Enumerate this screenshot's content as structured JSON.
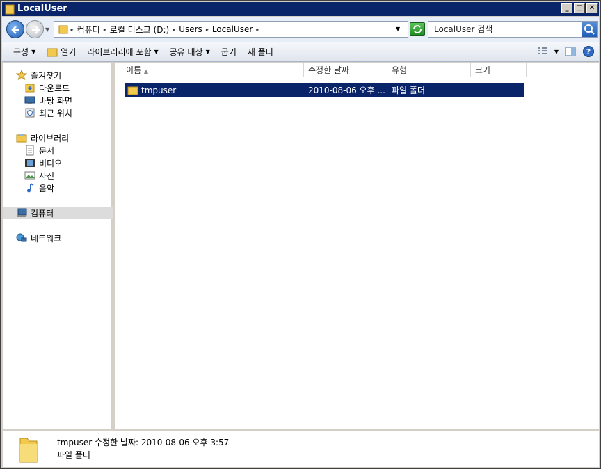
{
  "window": {
    "title": "LocalUser"
  },
  "title_buttons": [
    "_",
    "□",
    "✕"
  ],
  "address": {
    "crumbs": [
      "컴퓨터",
      "로컬 디스크 (D:)",
      "Users",
      "LocalUser"
    ]
  },
  "search": {
    "placeholder": "LocalUser 검색"
  },
  "commands": [
    {
      "label": "구성",
      "caret": "▼"
    },
    {
      "label": "열기"
    },
    {
      "label": "라이브러리에 포함",
      "caret": "▼"
    },
    {
      "label": "공유 대상",
      "caret": "▼"
    },
    {
      "label": "굽기"
    },
    {
      "label": "새 폴더"
    }
  ],
  "sidebar": {
    "favorites": {
      "label": "즐겨찾기",
      "items": [
        "다운로드",
        "바탕 화면",
        "최근 위치"
      ]
    },
    "libraries": {
      "label": "라이브러리",
      "items": [
        "문서",
        "비디오",
        "사진",
        "음악"
      ]
    },
    "computer": "컴퓨터",
    "network": "네트워크"
  },
  "columns": {
    "name": "이름",
    "modified": "수정한 날짜",
    "type": "유형",
    "size": "크기"
  },
  "files": [
    {
      "name": "tmpuser",
      "modified": "2010-08-06 오후 ...",
      "type": "파일 폴더",
      "size": ""
    }
  ],
  "status": {
    "line1": "tmpuser  수정한 날짜: 2010-08-06 오후 3:57",
    "line2": "파일 폴더"
  },
  "colors": {
    "titlebar": "#0a246a",
    "selection": "#0a246a",
    "folder": "#f2c94c"
  }
}
